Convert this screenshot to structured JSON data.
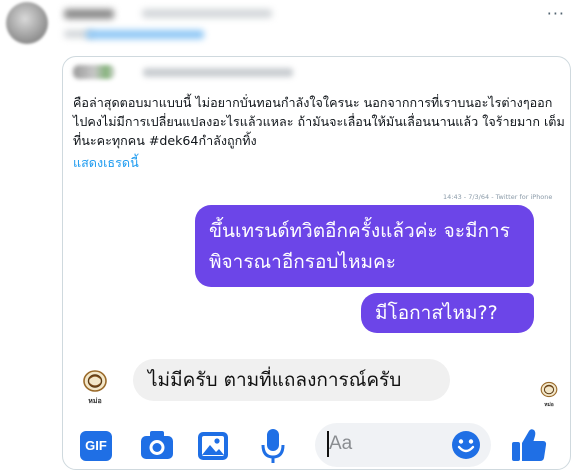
{
  "quote": {
    "text": "คือล่าสุดตอบมาแบบนี้ ไม่อยากบั่นทอนกำลังใจใครนะ นอกจากการที่เราบนอะไรต่างๆออกไปคงไม่มีการเปลี่ยนแปลงอะไรแล้วแหละ ถ้ามันจะเลื่อนให้มันเลื่อนนานแล้ว ใจร้ายมาก เต็มที่นะคะทุกคน #dek64กำลังถูกทิ้ง",
    "show_thread": "แสดงเธรดนี้"
  },
  "chat": {
    "timestamp": "14:43 - 7/3/64 - Twitter for iPhone",
    "outgoing": [
      "ขึ้นเทรนด์ทวิตอีกครั้งแล้วค่ะ จะมีการพิจารณาอีกรอบไหมคะ",
      "มีโอกาสไหม??"
    ],
    "incoming": [
      "ไม่มีครับ ตามที่แถลงการณ์ครับ"
    ],
    "seal_label": "หม่อ"
  },
  "composer": {
    "gif_label": "GIF",
    "placeholder": "Aa"
  },
  "colors": {
    "outgoing_bubble": "#6c45e8",
    "incoming_bubble": "#f0f0f0",
    "messenger_blue": "#1f6fe5",
    "link": "#1d9bf0"
  },
  "icons": [
    "more-icon",
    "gif-icon",
    "camera-icon",
    "image-icon",
    "mic-icon",
    "emoji-icon",
    "like-icon",
    "seal-icon"
  ]
}
